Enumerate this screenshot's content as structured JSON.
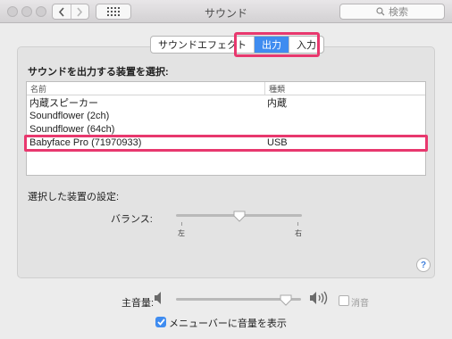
{
  "window": {
    "title": "サウンド",
    "search_placeholder": "検索"
  },
  "tabs": [
    {
      "label": "サウンドエフェクト",
      "selected": false
    },
    {
      "label": "出力",
      "selected": true
    },
    {
      "label": "入力",
      "selected": false
    }
  ],
  "output": {
    "section_label": "サウンドを出力する装置を選択:",
    "columns": {
      "name": "名前",
      "type": "種類"
    },
    "devices": [
      {
        "name": "内蔵スピーカー",
        "type": "内蔵"
      },
      {
        "name": "Soundflower (2ch)",
        "type": ""
      },
      {
        "name": "Soundflower (64ch)",
        "type": ""
      },
      {
        "name": "Babyface Pro (71970933)",
        "type": "USB"
      }
    ],
    "settings_label": "選択した装置の設定:",
    "balance": {
      "label": "バランス:",
      "left_label": "左",
      "right_label": "右",
      "value": 0.5
    }
  },
  "help": {
    "label": "?"
  },
  "footer": {
    "volume_label": "主音量:",
    "volume_value": 0.88,
    "mute_label": "消音",
    "mute_checked": false,
    "show_in_menubar_label": "メニューバーに音量を表示",
    "show_in_menubar_checked": true
  },
  "colors": {
    "accent": "#3f8cf0",
    "highlight": "#e8386e"
  }
}
